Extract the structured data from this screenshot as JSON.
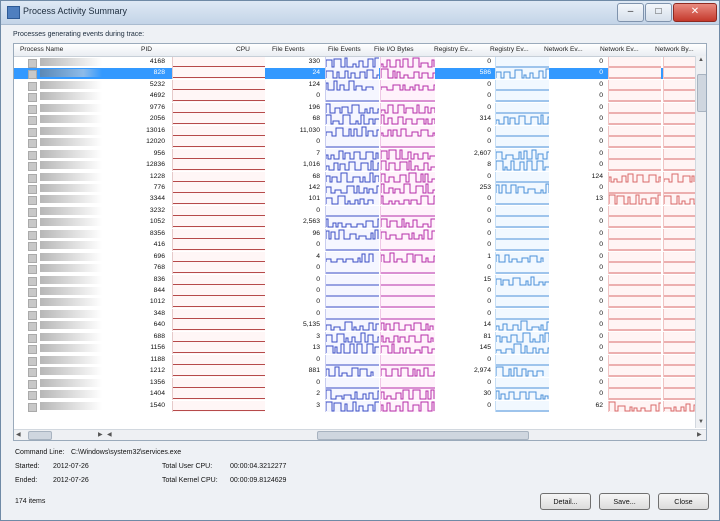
{
  "window": {
    "title": "Process Activity Summary",
    "buttons": {
      "minimize": "–",
      "maximize": "□",
      "close": "✕"
    }
  },
  "caption": "Processes generating events during trace:",
  "columns": [
    "Process Name",
    "PID",
    "CPU",
    "File Events",
    "File Events",
    "File I/O Bytes",
    "Registry Ev...",
    "Registry Ev...",
    "Network Ev...",
    "Network Ev...",
    "Network By..."
  ],
  "rows": [
    {
      "pid": "4168",
      "file_events": "330",
      "registry_events": "0",
      "network_events": "0"
    },
    {
      "pid": "828",
      "file_events": "24",
      "registry_events": "586",
      "network_events": "0"
    },
    {
      "pid": "5232",
      "file_events": "124",
      "registry_events": "0",
      "network_events": "0"
    },
    {
      "pid": "4692",
      "file_events": "0",
      "registry_events": "0",
      "network_events": "0"
    },
    {
      "pid": "9776",
      "file_events": "196",
      "registry_events": "0",
      "network_events": "0"
    },
    {
      "pid": "2056",
      "file_events": "68",
      "registry_events": "314",
      "network_events": "0"
    },
    {
      "pid": "13016",
      "file_events": "11,030",
      "registry_events": "0",
      "network_events": "0"
    },
    {
      "pid": "12020",
      "file_events": "0",
      "registry_events": "0",
      "network_events": "0"
    },
    {
      "pid": "956",
      "file_events": "7",
      "registry_events": "2,607",
      "network_events": "0"
    },
    {
      "pid": "12836",
      "file_events": "1,016",
      "registry_events": "8",
      "network_events": "0"
    },
    {
      "pid": "1228",
      "file_events": "68",
      "registry_events": "0",
      "network_events": "124"
    },
    {
      "pid": "776",
      "file_events": "142",
      "registry_events": "253",
      "network_events": "0"
    },
    {
      "pid": "3344",
      "file_events": "101",
      "registry_events": "0",
      "network_events": "13"
    },
    {
      "pid": "3232",
      "file_events": "0",
      "registry_events": "0",
      "network_events": "0"
    },
    {
      "pid": "1052",
      "file_events": "2,563",
      "registry_events": "0",
      "network_events": "0"
    },
    {
      "pid": "8356",
      "file_events": "96",
      "registry_events": "0",
      "network_events": "0"
    },
    {
      "pid": "416",
      "file_events": "0",
      "registry_events": "0",
      "network_events": "0"
    },
    {
      "pid": "696",
      "file_events": "4",
      "registry_events": "1",
      "network_events": "0"
    },
    {
      "pid": "768",
      "file_events": "0",
      "registry_events": "0",
      "network_events": "0"
    },
    {
      "pid": "836",
      "file_events": "0",
      "registry_events": "15",
      "network_events": "0"
    },
    {
      "pid": "844",
      "file_events": "0",
      "registry_events": "0",
      "network_events": "0"
    },
    {
      "pid": "1012",
      "file_events": "0",
      "registry_events": "0",
      "network_events": "0"
    },
    {
      "pid": "348",
      "file_events": "0",
      "registry_events": "0",
      "network_events": "0"
    },
    {
      "pid": "640",
      "file_events": "5,135",
      "registry_events": "14",
      "network_events": "0"
    },
    {
      "pid": "688",
      "file_events": "3",
      "registry_events": "81",
      "network_events": "0"
    },
    {
      "pid": "1156",
      "file_events": "13",
      "registry_events": "145",
      "network_events": "0"
    },
    {
      "pid": "1188",
      "file_events": "0",
      "registry_events": "0",
      "network_events": "0"
    },
    {
      "pid": "1212",
      "file_events": "881",
      "registry_events": "2,974",
      "network_events": "0"
    },
    {
      "pid": "1356",
      "file_events": "0",
      "registry_events": "0",
      "network_events": "0"
    },
    {
      "pid": "1404",
      "file_events": "2",
      "registry_events": "30",
      "network_events": "0"
    },
    {
      "pid": "1540",
      "file_events": "3",
      "registry_events": "0",
      "network_events": "62"
    }
  ],
  "details": {
    "command_line_label": "Command Line:",
    "command_line_value": "C:\\Windows\\system32\\services.exe",
    "started_label": "Started:",
    "started_value": "2012-07-26",
    "ended_label": "Ended:",
    "ended_value": "2012-07-26",
    "user_cpu_label": "Total User CPU:",
    "user_cpu_value": "00:00:04.3212277",
    "kernel_cpu_label": "Total Kernel CPU:",
    "kernel_cpu_value": "00:00:09.8124629",
    "items_count": "174 items"
  },
  "actions": {
    "detail": "Detail...",
    "save": "Save...",
    "close": "Close"
  },
  "colors": {
    "cpu": "#b64a4a",
    "file_events": "#3b4fc6",
    "file_io": "#b62fa8",
    "registry": "#4a91d9",
    "network": "#d86a6a",
    "selection": "#3399ff"
  }
}
